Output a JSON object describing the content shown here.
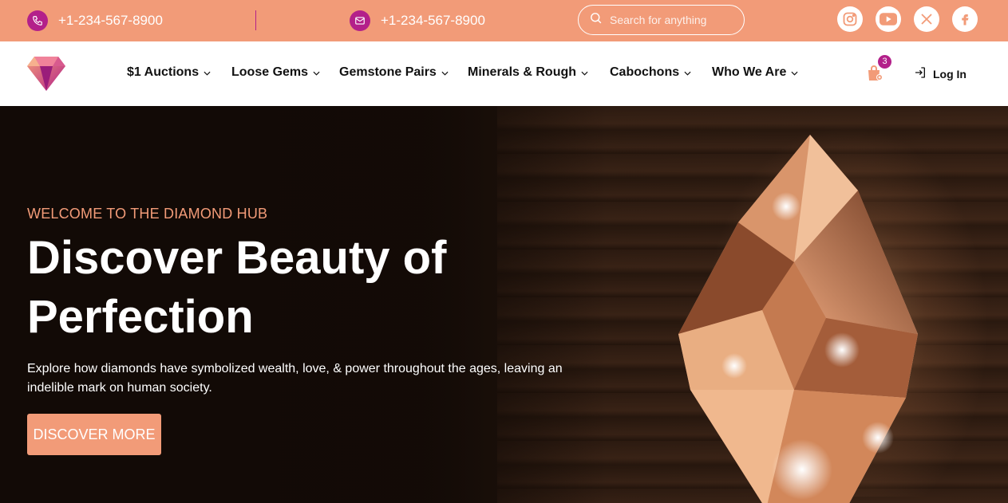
{
  "topbar": {
    "phone_text": "+1-234-567-8900",
    "mail_text": "+1-234-567-8900",
    "search_placeholder": "Search for anything",
    "social": [
      "instagram-icon",
      "youtube-icon",
      "x-icon",
      "facebook-icon"
    ]
  },
  "nav": {
    "items": [
      {
        "label": "$1 Auctions"
      },
      {
        "label": "Loose Gems"
      },
      {
        "label": "Gemstone Pairs"
      },
      {
        "label": "Minerals & Rough"
      },
      {
        "label": "Cabochons"
      },
      {
        "label": "Who We Are"
      }
    ],
    "cart_count": "3",
    "login_label": "Log In"
  },
  "hero": {
    "kicker": "WELCOME TO THE DIAMOND HUB",
    "headline": "Discover Beauty of Perfection",
    "description": "Explore how diamonds have symbolized wealth, love, & power throughout the ages, leaving an indelible mark on human society.",
    "cta_label": "DISCOVER MORE"
  },
  "colors": {
    "accent": "#f29b78",
    "brand_magenta": "#b3208a"
  }
}
